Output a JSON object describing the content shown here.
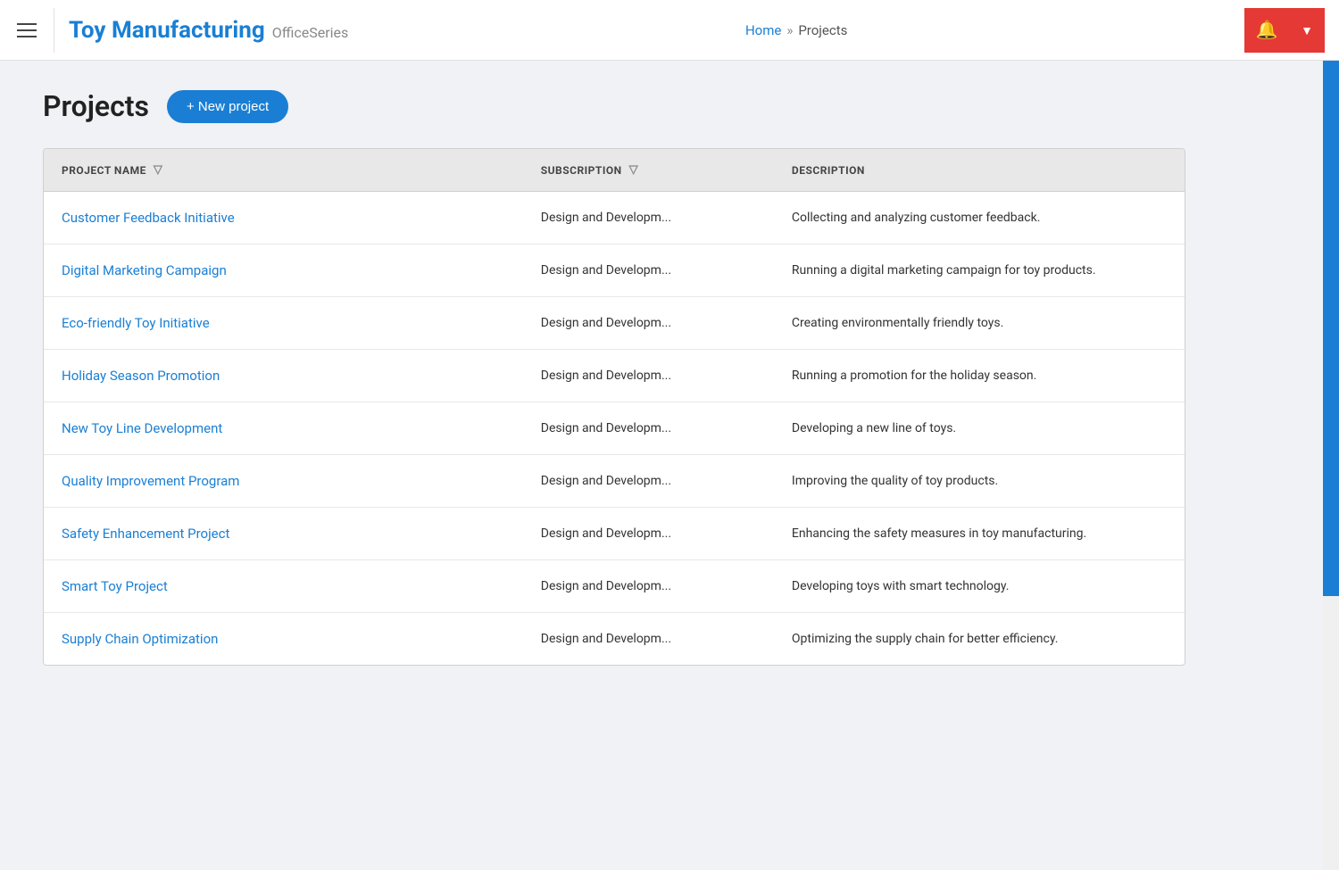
{
  "navbar": {
    "title": "Toy Manufacturing",
    "subtitle": "OfficeSeries",
    "breadcrumb": {
      "home": "Home",
      "separator": "»",
      "current": "Projects"
    },
    "bell_label": "🔔",
    "dropdown_label": "▼"
  },
  "page": {
    "title": "Projects",
    "new_project_btn": "+ New project"
  },
  "table": {
    "columns": [
      {
        "key": "name",
        "label": "PROJECT NAME",
        "filterable": true
      },
      {
        "key": "subscription",
        "label": "SUBSCRIPTION",
        "filterable": true
      },
      {
        "key": "description",
        "label": "DESCRIPTION",
        "filterable": false
      }
    ],
    "rows": [
      {
        "name": "Customer Feedback Initiative",
        "subscription": "Design and Developm...",
        "description": "Collecting and analyzing customer feedback."
      },
      {
        "name": "Digital Marketing Campaign",
        "subscription": "Design and Developm...",
        "description": "Running a digital marketing campaign for toy products."
      },
      {
        "name": "Eco-friendly Toy Initiative",
        "subscription": "Design and Developm...",
        "description": "Creating environmentally friendly toys."
      },
      {
        "name": "Holiday Season Promotion",
        "subscription": "Design and Developm...",
        "description": "Running a promotion for the holiday season."
      },
      {
        "name": "New Toy Line Development",
        "subscription": "Design and Developm...",
        "description": "Developing a new line of toys."
      },
      {
        "name": "Quality Improvement Program",
        "subscription": "Design and Developm...",
        "description": "Improving the quality of toy products."
      },
      {
        "name": "Safety Enhancement Project",
        "subscription": "Design and Developm...",
        "description": "Enhancing the safety measures in toy manufacturing."
      },
      {
        "name": "Smart Toy Project",
        "subscription": "Design and Developm...",
        "description": "Developing toys with smart technology."
      },
      {
        "name": "Supply Chain Optimization",
        "subscription": "Design and Developm...",
        "description": "Optimizing the supply chain for better efficiency."
      }
    ]
  }
}
